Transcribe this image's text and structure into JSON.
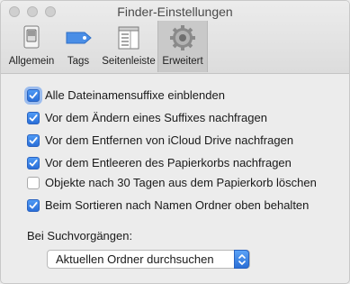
{
  "window": {
    "title": "Finder-Einstellungen"
  },
  "toolbar": {
    "tabs": [
      {
        "label": "Allgemein",
        "icon": "switch-icon",
        "active": false
      },
      {
        "label": "Tags",
        "icon": "tag-icon",
        "active": false
      },
      {
        "label": "Seitenleiste",
        "icon": "sidebar-icon",
        "active": false
      },
      {
        "label": "Erweitert",
        "icon": "gear-icon",
        "active": true
      }
    ]
  },
  "options": [
    {
      "label": "Alle Dateinamensuffixe einblenden",
      "checked": true
    },
    {
      "label": "Vor dem Ändern eines Suffixes nachfragen",
      "checked": true
    },
    {
      "label": "Vor dem Entfernen von iCloud Drive nachfragen",
      "checked": true
    },
    {
      "label": "Vor dem Entleeren des Papierkorbs nachfragen",
      "checked": true
    },
    {
      "label": "Objekte nach 30 Tagen aus dem Papierkorb löschen",
      "checked": false
    },
    {
      "label": "Beim Sortieren nach Namen Ordner oben behalten",
      "checked": true
    }
  ],
  "search": {
    "section_label": "Bei Suchvorgängen:",
    "selected": "Aktuellen Ordner durchsuchen"
  },
  "colors": {
    "accent": "#2f78e0",
    "window_bg": "#ececec",
    "active_tab_bg": "#c9c9c9"
  }
}
